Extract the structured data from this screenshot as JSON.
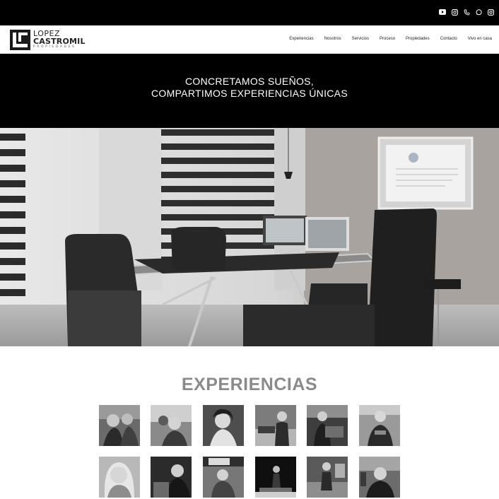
{
  "social_icons": [
    "youtube-icon",
    "instagram-icon",
    "phone-icon",
    "whatsapp-icon",
    "instagram-icon"
  ],
  "logo": {
    "line1": "LOPEZ",
    "line2": "CASTROMIL",
    "line3": "PROPIEDADES"
  },
  "nav": {
    "items": [
      {
        "label": "Experiencias"
      },
      {
        "label": "Nosotros"
      },
      {
        "label": "Servicios"
      },
      {
        "label": "Proceso"
      },
      {
        "label": "Propiedades"
      },
      {
        "label": "Contacto"
      },
      {
        "label": "Vivo en casa"
      }
    ]
  },
  "hero": {
    "line1": "CONCRETAMOS SUEÑOS,",
    "line2": "COMPARTIMOS EXPERIENCIAS ÚNICAS"
  },
  "experiences": {
    "title": "EXPERIENCIAS"
  }
}
